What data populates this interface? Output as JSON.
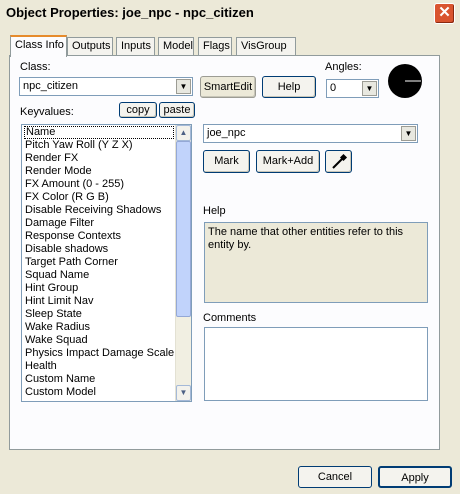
{
  "window": {
    "title": "Object Properties: joe_npc - npc_citizen",
    "close_glyph": "✕"
  },
  "tabs": [
    {
      "label": "Class Info",
      "active": true
    },
    {
      "label": "Outputs"
    },
    {
      "label": "Inputs"
    },
    {
      "label": "Model"
    },
    {
      "label": "Flags"
    },
    {
      "label": "VisGroup"
    }
  ],
  "class_info": {
    "class_label": "Class:",
    "class_value": "npc_citizen",
    "smartedit_label": "SmartEdit",
    "help_button": "Help",
    "angles_label": "Angles:",
    "angles_value": "0",
    "keyvalues_label": "Keyvalues:",
    "copy_button": "copy",
    "paste_button": "paste",
    "keyvalues": [
      "Name",
      "Pitch Yaw Roll (Y Z X)",
      "Render FX",
      "Render Mode",
      "FX Amount (0 - 255)",
      "FX Color (R G B)",
      "Disable Receiving Shadows",
      "Damage Filter",
      "Response Contexts",
      "Disable shadows",
      "Target Path Corner",
      "Squad Name",
      "Hint Group",
      "Hint Limit Nav",
      "Sleep State",
      "Wake Radius",
      "Wake Squad",
      "Physics Impact Damage Scale",
      "Health",
      "Custom Name",
      "Custom Model"
    ],
    "selected_key": "Name",
    "value_field": "joe_npc",
    "mark_button": "Mark",
    "mark_add_button": "Mark+Add",
    "help_section_label": "Help",
    "help_text": "The name that other entities refer to this entity by.",
    "comments_label": "Comments",
    "comments_text": ""
  },
  "footer": {
    "cancel_button": "Cancel",
    "apply_button": "Apply"
  },
  "icons": {
    "dropdown": "chevron-down-icon",
    "picker": "eyedropper-icon",
    "angle": "angle-dial-icon"
  }
}
